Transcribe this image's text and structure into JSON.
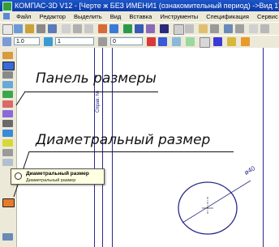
{
  "window": {
    "title": "КОМПАС-3D V12 - [Черте ж БЕЗ ИМЕНИ1 (ознакомительный период) ->Вид 1]"
  },
  "menu": {
    "items": [
      "Файл",
      "Редактор",
      "Выделить",
      "Вид",
      "Вставка",
      "Инструменты",
      "Спецификация",
      "Сервис"
    ]
  },
  "toolbar2": {
    "scale_value": "1.0",
    "layer_value": "1",
    "field3_value": "0"
  },
  "annotations": {
    "panel_label": "Панель размеры",
    "diameter_label": "Диаметральный размер"
  },
  "tooltip": {
    "title": "Диаметральный размер",
    "subtitle": "Диаметральный размер"
  },
  "drawing": {
    "dimension_text": "ø40",
    "vertical_text": "Справ. №"
  },
  "colors": {
    "title_bar": "#0b3aa8",
    "menu_bg": "#ece9d8",
    "drawing_line": "#2a2a8a"
  }
}
